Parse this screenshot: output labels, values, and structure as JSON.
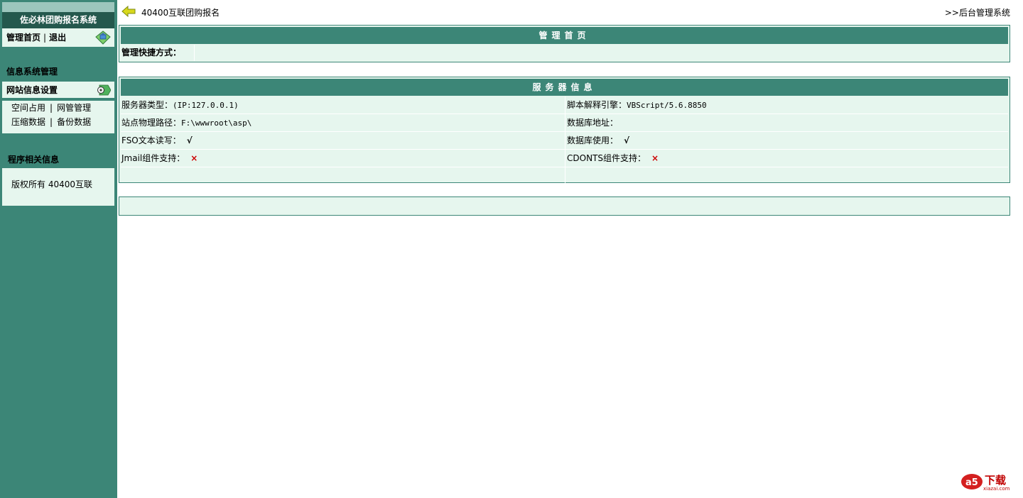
{
  "sidebar": {
    "title": "佐必林团购报名系统",
    "home_link": "管理首页",
    "divider": "|",
    "logout_link": "退出",
    "section_info": "信息系统管理",
    "group_title": "网站信息设置",
    "group_links_row1": [
      "空间占用",
      "网管管理"
    ],
    "group_links_row2": [
      "压缩数据",
      "备份数据"
    ],
    "section_program": "程序相关信息",
    "copyright": "版权所有 40400互联"
  },
  "topbar": {
    "site_title": "40400互联团购报名",
    "admin_link": ">>后台管理系统"
  },
  "panel_home": {
    "header": "管理首页",
    "shortcut_label": "管理快捷方式："
  },
  "panel_server": {
    "header": "服务器信息",
    "rows": [
      {
        "left_label": "服务器类型：",
        "left_value": "(IP:127.0.0.1)",
        "right_label": "脚本解释引擎：",
        "right_value": "VBScript/5.6.8850"
      },
      {
        "left_label": "站点物理路径：",
        "left_value": "F:\\wwwroot\\asp\\",
        "right_label": "数据库地址：",
        "right_value": ""
      },
      {
        "left_label": "FSO文本读写：",
        "left_value": "√",
        "right_label": "数据库使用：",
        "right_value": "√"
      },
      {
        "left_label": "Jmail组件支持：",
        "left_value": "×",
        "right_label": "CDONTS组件支持：",
        "right_value": "×"
      }
    ]
  },
  "watermark": {
    "brand": "下载",
    "url": "xiazai.com"
  },
  "colors": {
    "teal": "#3c8677",
    "dark_teal": "#24584d",
    "panel_bg": "#e6f6ee",
    "error": "#cc0000"
  }
}
